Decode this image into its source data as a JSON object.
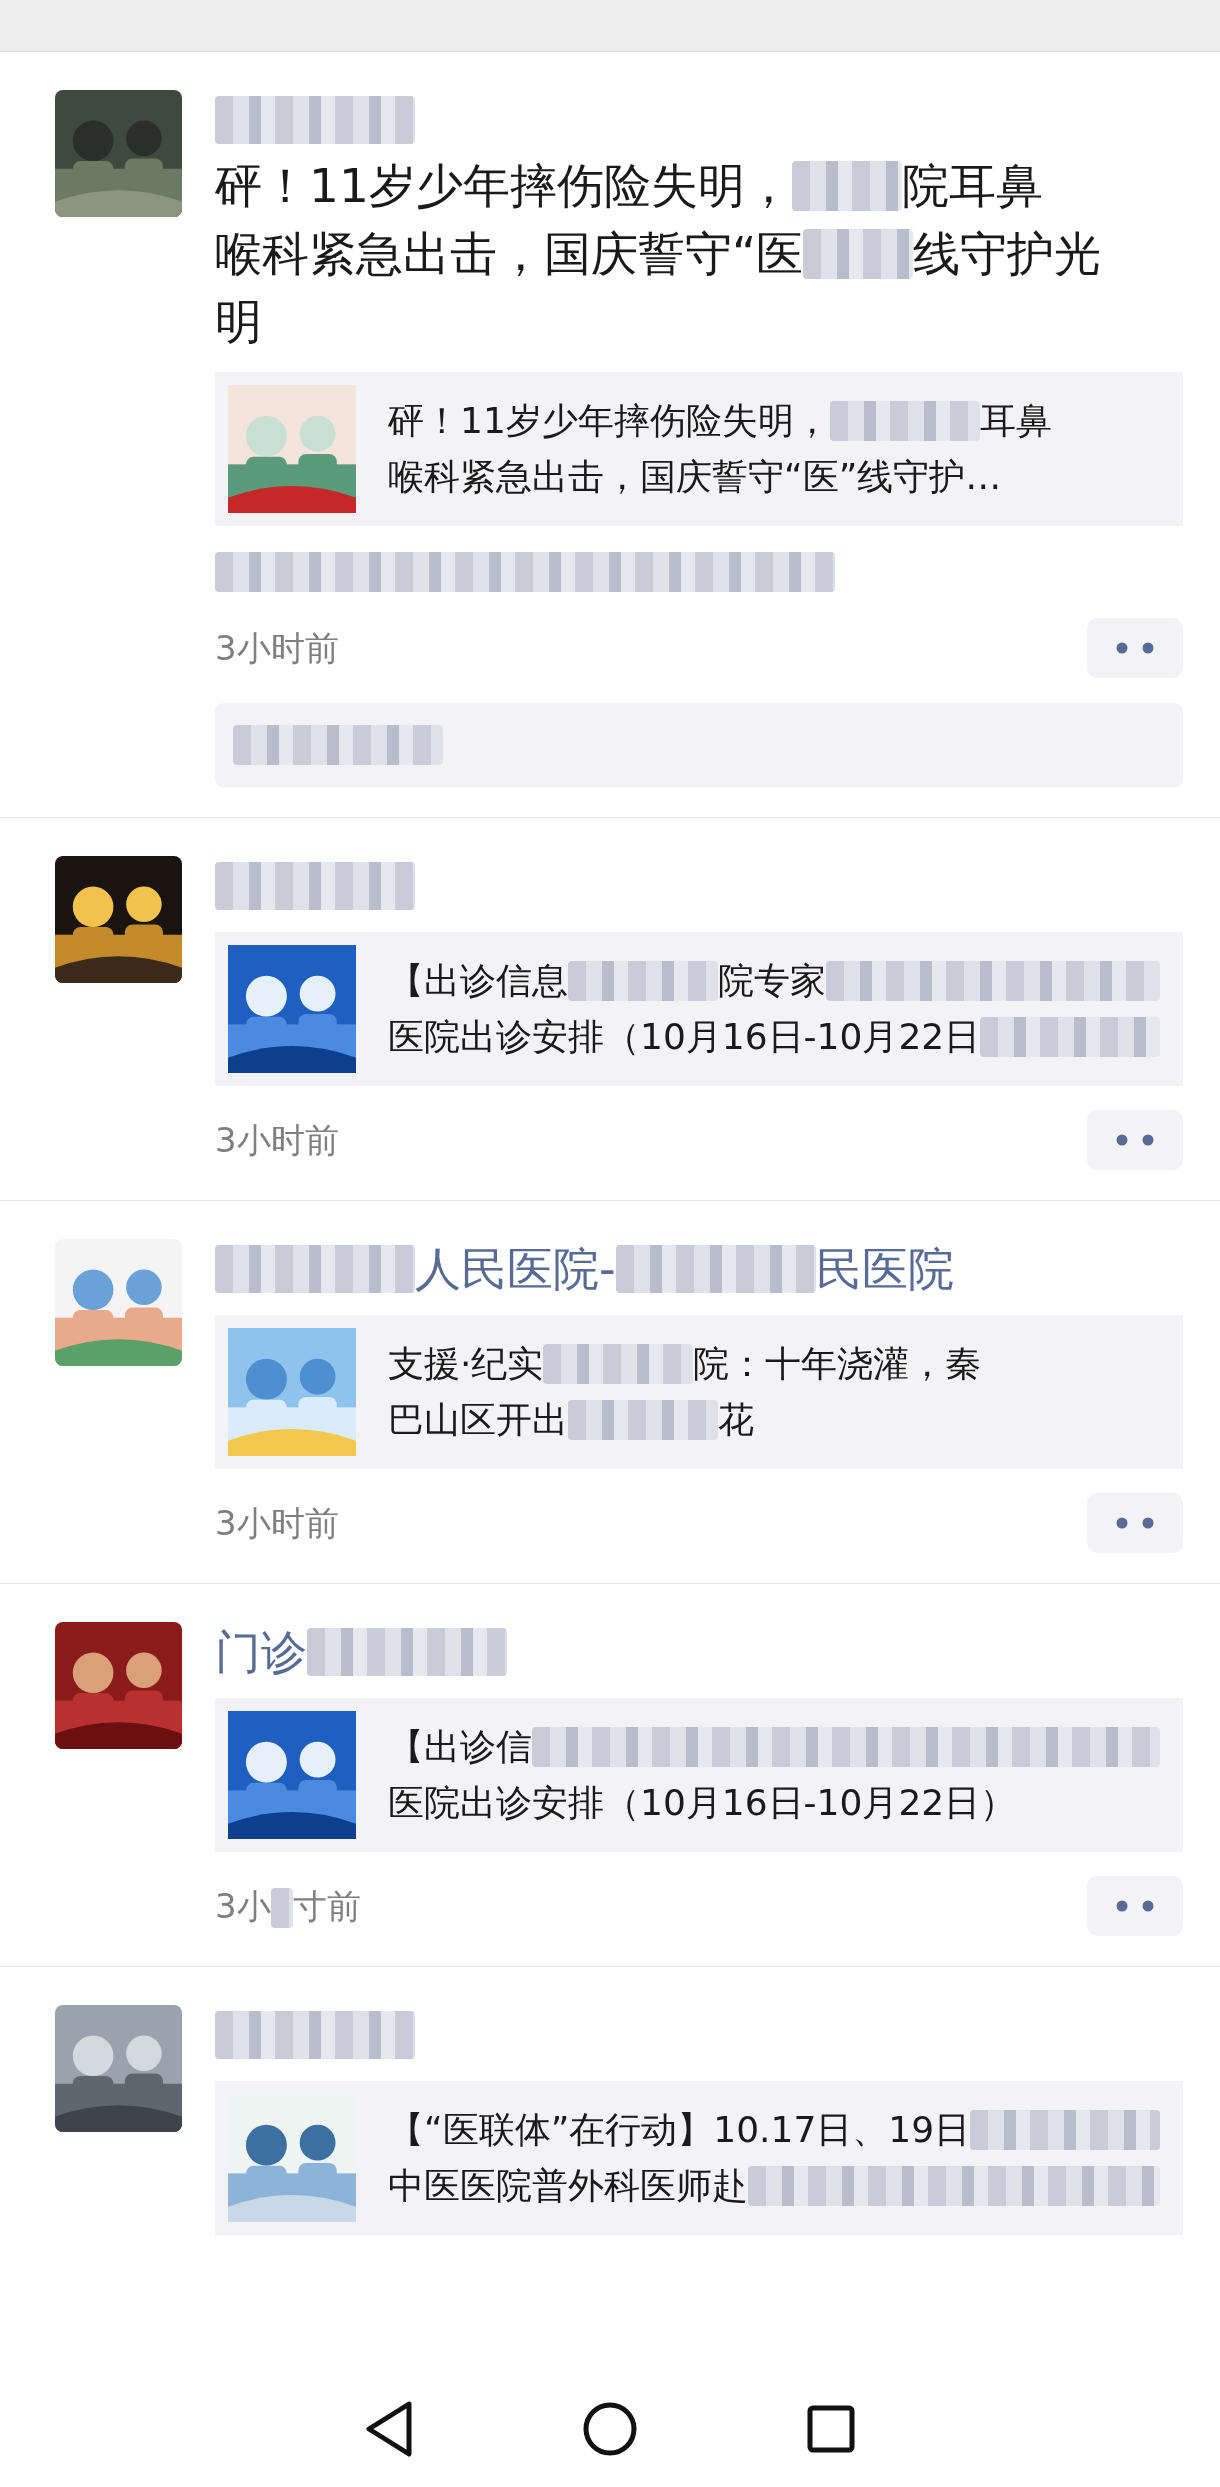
{
  "posts": [
    {
      "avatar": {
        "kind": "picture"
      },
      "name": [
        {
          "kind": "blur"
        }
      ],
      "body": [
        [
          {
            "kind": "text",
            "text": "砰！11岁少年摔伤险失明，"
          },
          {
            "kind": "blur"
          },
          {
            "kind": "text",
            "text": "院耳鼻"
          }
        ],
        [
          {
            "kind": "text",
            "text": "喉科紧急出击，国庆誓守“医"
          },
          {
            "kind": "blur"
          },
          {
            "kind": "text",
            "text": "线守护光"
          }
        ],
        [
          {
            "kind": "text",
            "text": "明"
          }
        ]
      ],
      "card": {
        "thumb": {
          "kind": "picture"
        },
        "lines": [
          [
            {
              "kind": "text",
              "text": "砰！11岁少年摔伤险失明，"
            },
            {
              "kind": "blur"
            },
            {
              "kind": "text",
              "text": "耳鼻"
            }
          ],
          [
            {
              "kind": "text",
              "text": "喉科紧急出击，国庆誓守“医”线守护…"
            }
          ]
        ]
      },
      "note": [
        {
          "kind": "blur"
        }
      ],
      "time": [
        {
          "kind": "text",
          "text": "3小时前"
        }
      ],
      "comment": [
        {
          "kind": "blur"
        }
      ]
    },
    {
      "avatar": {
        "kind": "picture"
      },
      "name": [
        {
          "kind": "blur"
        }
      ],
      "card": {
        "thumb": {
          "kind": "picture"
        },
        "lines": [
          [
            {
              "kind": "text",
              "text": "【出诊信息"
            },
            {
              "kind": "blur"
            },
            {
              "kind": "text",
              "text": "院专家"
            },
            {
              "kind": "blur"
            }
          ],
          [
            {
              "kind": "text",
              "text": "医院出诊安排（10月16日-10月22日"
            },
            {
              "kind": "blur"
            }
          ]
        ]
      },
      "time": [
        {
          "kind": "text",
          "text": "3小时前"
        }
      ]
    },
    {
      "avatar": {
        "kind": "picture"
      },
      "name": [
        {
          "kind": "blur"
        },
        {
          "kind": "text",
          "text": "人民医院-"
        },
        {
          "kind": "blur"
        },
        {
          "kind": "text",
          "text": "民医院"
        }
      ],
      "card": {
        "thumb": {
          "kind": "picture"
        },
        "lines": [
          [
            {
              "kind": "text",
              "text": "支援·纪实"
            },
            {
              "kind": "blur"
            },
            {
              "kind": "text",
              "text": "院：十年浇灌，秦"
            }
          ],
          [
            {
              "kind": "text",
              "text": "巴山区开出"
            },
            {
              "kind": "blur"
            },
            {
              "kind": "text",
              "text": "花"
            }
          ]
        ]
      },
      "time": [
        {
          "kind": "text",
          "text": "3小时前"
        }
      ]
    },
    {
      "avatar": {
        "kind": "picture"
      },
      "name": [
        {
          "kind": "text",
          "text": "门诊"
        },
        {
          "kind": "blur"
        }
      ],
      "card": {
        "thumb": {
          "kind": "picture"
        },
        "lines": [
          [
            {
              "kind": "text",
              "text": "【出诊信"
            },
            {
              "kind": "blur"
            }
          ],
          [
            {
              "kind": "text",
              "text": "医院出诊安排（10月16日-10月22日）"
            }
          ]
        ]
      },
      "time": [
        {
          "kind": "text",
          "text": "3小"
        },
        {
          "kind": "blur"
        },
        {
          "kind": "text",
          "text": "寸前"
        }
      ]
    },
    {
      "avatar": {
        "kind": "picture"
      },
      "name": [
        {
          "kind": "blur"
        }
      ],
      "card": {
        "thumb": {
          "kind": "picture"
        },
        "lines": [
          [
            {
              "kind": "text",
              "text": "【“医联体”在行动】10.17日、19日"
            },
            {
              "kind": "blur"
            }
          ],
          [
            {
              "kind": "text",
              "text": "中医医院普外科医师赴"
            },
            {
              "kind": "blur"
            }
          ]
        ]
      }
    }
  ]
}
